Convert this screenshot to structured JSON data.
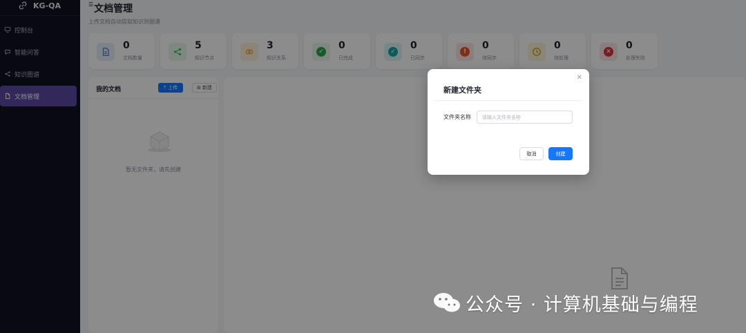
{
  "app": {
    "title": "KG-QA"
  },
  "sidebar": {
    "items": [
      {
        "label": "控制台",
        "icon": "monitor-icon",
        "active": false
      },
      {
        "label": "智能问答",
        "icon": "chat-icon",
        "active": false
      },
      {
        "label": "知识图谱",
        "icon": "share-icon",
        "active": false
      },
      {
        "label": "文档管理",
        "icon": "document-icon",
        "active": true
      }
    ]
  },
  "header": {
    "title": "文档管理",
    "subtitle": "上传文档自动提取知识到图谱"
  },
  "stats": [
    {
      "value": "0",
      "label": "文档数量",
      "icon": "document-icon",
      "color": "#4a7bdc",
      "bg": "#e6eefb"
    },
    {
      "value": "5",
      "label": "知识节点",
      "icon": "share-icon",
      "color": "#3fbf5a",
      "bg": "#e5f7e9"
    },
    {
      "value": "3",
      "label": "知识关系",
      "icon": "link-icon",
      "color": "#f0a33a",
      "bg": "#fdf0dc"
    },
    {
      "value": "0",
      "label": "已完成",
      "icon": "check-circle-icon",
      "color": "#2ea44f",
      "bg": "#e5f7e9"
    },
    {
      "value": "0",
      "label": "已同步",
      "icon": "check-circle-icon",
      "color": "#13a8a8",
      "bg": "#dff5f5"
    },
    {
      "value": "0",
      "label": "待同步",
      "icon": "alert-circle-icon",
      "color": "#e8542e",
      "bg": "#fde8e2"
    },
    {
      "value": "0",
      "label": "待处理",
      "icon": "clock-icon",
      "color": "#d9a21b",
      "bg": "#fbf2d9"
    },
    {
      "value": "0",
      "label": "处理失败",
      "icon": "close-circle-icon",
      "color": "#d9363e",
      "bg": "#fce4e5"
    }
  ],
  "folders": {
    "title": "我的文档",
    "upload_label": "上传",
    "new_label": "新建",
    "empty_text": "暂无文件夹，请先创建"
  },
  "modal": {
    "title": "新建文件夹",
    "field_label": "文件夹名称",
    "placeholder": "请输入文件夹名称",
    "cancel_label": "取消",
    "create_label": "创建"
  },
  "watermark": {
    "text": "公众号 · 计算机基础与编程"
  }
}
